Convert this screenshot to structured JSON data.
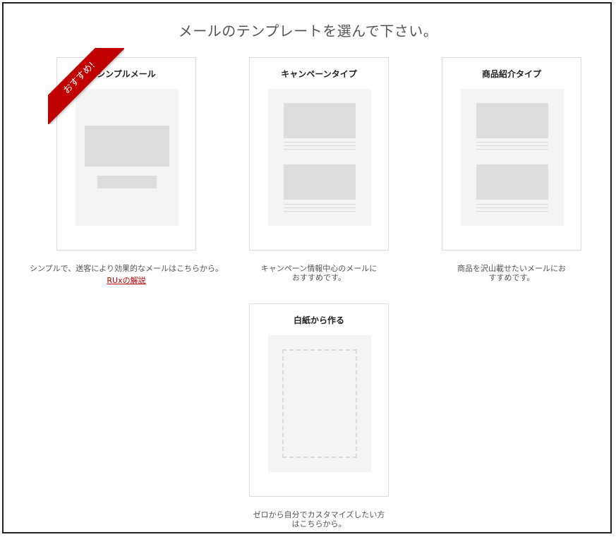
{
  "page": {
    "title": "メールのテンプレートを選んで下さい。"
  },
  "badge": {
    "label": "おすすめ!",
    "color": "#c00000"
  },
  "templates": [
    {
      "title": "シンプルメール",
      "description": "シンプルで、送客により効果的なメールはこちらから。",
      "link": "RUxの解説"
    },
    {
      "title": "キャンペーンタイプ",
      "description": "キャンペーン情報中心のメールにおすすめです。"
    },
    {
      "title": "商品紹介タイプ",
      "description": "商品を沢山載せたいメールにおすすめです。"
    },
    {
      "title": "白紙から作る",
      "description": "ゼロから自分でカスタマイズしたい方はこちらから。"
    }
  ]
}
